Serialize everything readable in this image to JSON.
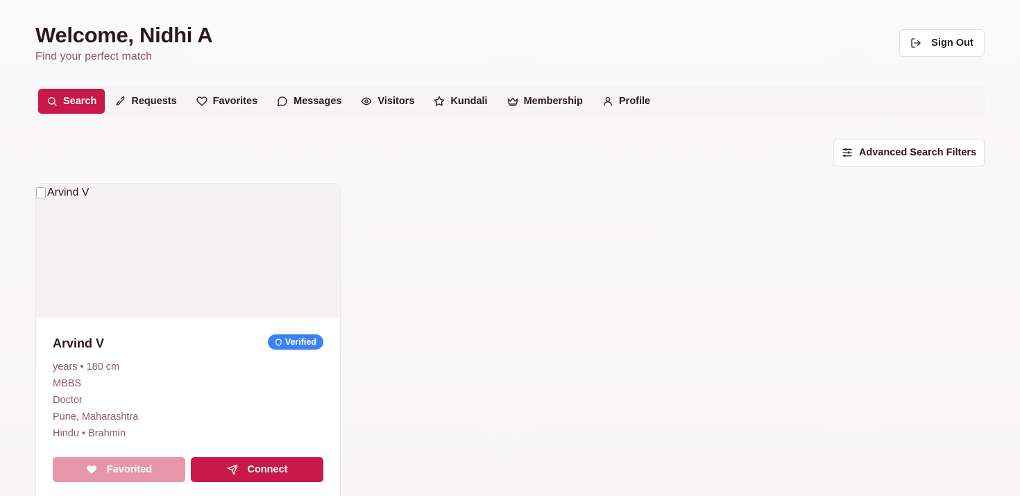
{
  "header": {
    "title": "Welcome, Nidhi A",
    "subtitle": "Find your perfect match"
  },
  "signout": {
    "label": "Sign Out",
    "icon": "logout-icon"
  },
  "tabs": [
    {
      "label": "Search",
      "icon": "search-icon",
      "active": true
    },
    {
      "label": "Requests",
      "icon": "handshake-icon",
      "active": false
    },
    {
      "label": "Favorites",
      "icon": "heart-icon",
      "active": false
    },
    {
      "label": "Messages",
      "icon": "chat-bubble-icon",
      "active": false
    },
    {
      "label": "Visitors",
      "icon": "eye-icon",
      "active": false
    },
    {
      "label": "Kundali",
      "icon": "star-icon",
      "active": false
    },
    {
      "label": "Membership",
      "icon": "crown-icon",
      "active": false
    },
    {
      "label": "Profile",
      "icon": "user-icon",
      "active": false
    }
  ],
  "filters": {
    "label": "Advanced Search Filters",
    "icon": "sliders-icon"
  },
  "profile_card": {
    "photo_alt": "Arvind V",
    "name": "Arvind V",
    "badge": "Verified",
    "age_height": "years • 180 cm",
    "education": "MBBS",
    "occupation": "Doctor",
    "location": "Pune, Maharashtra",
    "religion_caste": "Hindu • Brahmin",
    "favorite_label": "Favorited",
    "connect_label": "Connect"
  },
  "colors": {
    "accent": "#c8194a",
    "accent_muted": "#e696a9",
    "badge_blue": "#3b82f6",
    "muted_text": "#8a5a68"
  }
}
